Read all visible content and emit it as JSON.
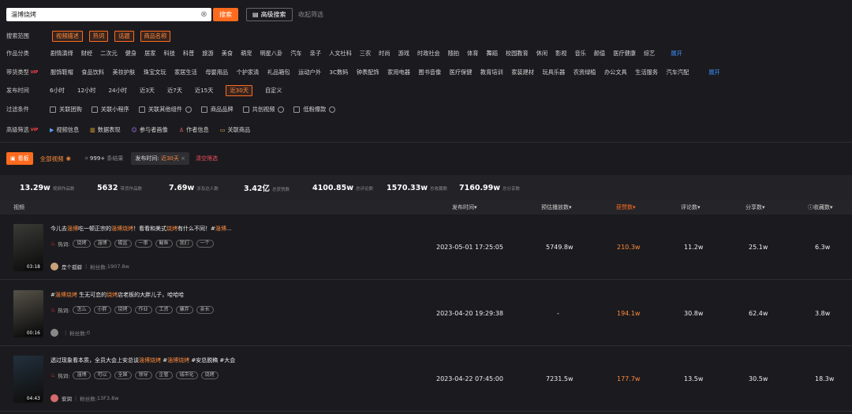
{
  "search": {
    "value": "淄博烧烤",
    "button": "搜索",
    "advanced": "高级搜索",
    "collapse": "收起筛选"
  },
  "scope": {
    "label": "搜索范围",
    "tags": [
      "视频描述",
      "热词",
      "话题",
      "商品名称"
    ]
  },
  "category": {
    "label": "作品分类",
    "options": [
      "剧情演绎",
      "财经",
      "二次元",
      "健身",
      "居家",
      "科技",
      "科普",
      "旅游",
      "美食",
      "萌宠",
      "明星八卦",
      "汽车",
      "亲子",
      "人文社科",
      "三农",
      "时尚",
      "游戏",
      "时政社会",
      "随拍",
      "体育",
      "舞蹈",
      "校园教育",
      "休闲",
      "影视",
      "音乐",
      "颜值",
      "医疗健康",
      "综艺"
    ],
    "more": "展开"
  },
  "goods": {
    "label": "带货类型",
    "vip": "VIP",
    "options": [
      "服饰鞋帽",
      "食品饮料",
      "美妆护肤",
      "珠宝文玩",
      "家居生活",
      "母婴用品",
      "个护家清",
      "礼品箱包",
      "运动户外",
      "3C数码",
      "钟表配饰",
      "家用电器",
      "图书音像",
      "医疗保健",
      "教育培训",
      "家装建材",
      "玩具乐器",
      "农资绿植",
      "办公文具",
      "生活服务",
      "汽车汽配"
    ],
    "more": "展开"
  },
  "time": {
    "label": "发布时间",
    "options": [
      "6小时",
      "12小时",
      "24小时",
      "近3天",
      "近7天",
      "近15天",
      "近30天",
      "自定义"
    ],
    "selected": "近30天"
  },
  "filters": {
    "label": "过滤条件",
    "items": [
      "关联团购",
      "关联小程序",
      "关联其他组件",
      "商品品牌",
      "共创视频",
      "低粉爆款"
    ]
  },
  "advanced_filter": {
    "label": "高级筛选",
    "vip": "VIP",
    "items": [
      "视频信息",
      "数据表现",
      "参与者画像",
      "作者信息",
      "关联商品"
    ]
  },
  "toolbar": {
    "dashboard": "看板",
    "all_videos": "全部视频",
    "count_value": "999+",
    "count_suffix": "条结果",
    "time_chip_label": "发布时间:",
    "time_chip_value": "近30天",
    "clear": "清空筛选"
  },
  "stats": [
    {
      "value": "13.29w",
      "label": "视频作品数"
    },
    {
      "value": "5632",
      "label": "带货作品数"
    },
    {
      "value": "7.69w",
      "label": "涉及达人数"
    },
    {
      "value": "3.42亿",
      "label": "总获赞数"
    },
    {
      "value": "4100.85w",
      "label": "总评论数"
    },
    {
      "value": "1570.33w",
      "label": "总收藏数"
    },
    {
      "value": "7160.99w",
      "label": "总分享数"
    }
  ],
  "table": {
    "headers": {
      "video": "视频",
      "time": "发布时间",
      "plays": "预估播放数",
      "likes": "获赞数",
      "comments": "评论数",
      "shares": "分享数",
      "favorites": "收藏数"
    },
    "hot_label": "热词:",
    "fans_label": "粉丝数:",
    "rows": [
      {
        "title_parts": [
          "今儿去",
          "淄博",
          "吃一顿正宗的",
          "淄博烧烤",
          "！看看和美式",
          "烧烤",
          "有什么不同！#",
          "淄博",
          "..."
        ],
        "duration": "03:18",
        "hotwords": [
          "烧烤",
          "淄博",
          "碳盆",
          "一串",
          "鲅鱼",
          "我们",
          "一个"
        ],
        "author": "是个孤僻",
        "fans": "1907.8w",
        "time": "2023-05-01 17:25:05",
        "plays": "5749.8w",
        "likes": "210.3w",
        "comments": "11.2w",
        "shares": "25.1w",
        "favorites": "6.3w",
        "thumb_color": "#3a3a36"
      },
      {
        "title_parts": [
          "#",
          "淄博烧烤",
          " 生无可恋的",
          "烧烤",
          "店老板的大胖儿子，哈哈哈"
        ],
        "duration": "00:16",
        "hotwords": [
          "怎么",
          "小胖",
          "烧烤",
          "作业",
          "工资",
          "嫌弃",
          "亲长"
        ],
        "author": "",
        "fans": "0",
        "time": "2023-04-20 19:29:38",
        "plays": "-",
        "likes": "194.1w",
        "comments": "30.8w",
        "shares": "62.4w",
        "favorites": "3.8w",
        "thumb_color": "#565248"
      },
      {
        "title_parts": [
          "透过现象看本质，全员大会上安总谈",
          "淄博烧烤",
          " #",
          "淄博烧烤",
          " #安总脱稿 #大会"
        ],
        "duration": "04:43",
        "hotwords": [
          "淄博",
          "可以",
          "全国",
          "领导",
          "企管",
          "城市化",
          "烧烤"
        ],
        "author": "安润",
        "fans": "13F3.8w",
        "time": "2023-04-22 07:45:00",
        "plays": "7231.5w",
        "likes": "177.7w",
        "comments": "13.5w",
        "shares": "30.5w",
        "favorites": "18.3w",
        "thumb_color": "#22303e"
      }
    ]
  }
}
